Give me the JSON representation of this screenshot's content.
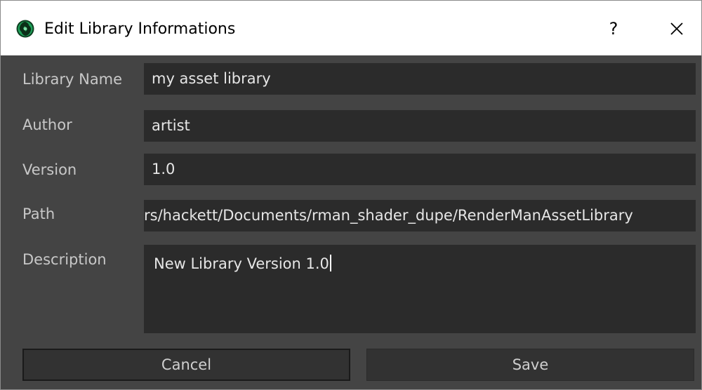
{
  "window": {
    "title": "Edit Library Informations",
    "help_label": "?",
    "app_icon": "renderman-icon",
    "close_icon": "close-icon"
  },
  "form": {
    "library_name": {
      "label": "Library Name",
      "value": "my asset library"
    },
    "author": {
      "label": "Author",
      "value": "artist"
    },
    "version": {
      "label": "Version",
      "value": "1.0"
    },
    "path": {
      "label": "Path",
      "value": "rs/hackett/Documents/rman_shader_dupe/RenderManAssetLibrary"
    },
    "description": {
      "label": "Description",
      "value": "New Library Version 1.0"
    }
  },
  "buttons": {
    "cancel_label": "Cancel",
    "save_label": "Save"
  },
  "colors": {
    "background": "#444444",
    "field": "#2b2b2b",
    "accent_icon": "#1fa25a"
  }
}
